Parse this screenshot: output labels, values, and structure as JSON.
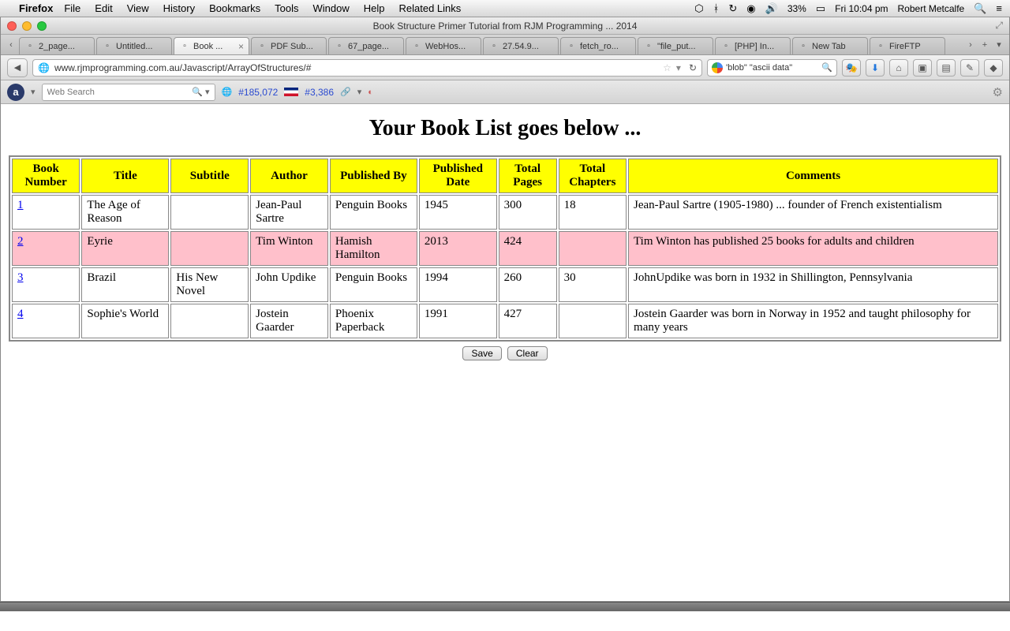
{
  "menubar": {
    "app": "Firefox",
    "items": [
      "File",
      "Edit",
      "View",
      "History",
      "Bookmarks",
      "Tools",
      "Window",
      "Help",
      "Related Links"
    ],
    "battery": "33%",
    "time": "Fri 10:04 pm",
    "user": "Robert Metcalfe"
  },
  "window": {
    "title": "Book Structure Primer Tutorial from RJM Programming ... 2014"
  },
  "tabs": [
    {
      "label": "2_page...",
      "active": false
    },
    {
      "label": "Untitled...",
      "active": false
    },
    {
      "label": "Book ...",
      "active": true
    },
    {
      "label": "PDF Sub...",
      "active": false
    },
    {
      "label": "67_page...",
      "active": false
    },
    {
      "label": "WebHos...",
      "active": false
    },
    {
      "label": "27.54.9...",
      "active": false
    },
    {
      "label": "fetch_ro...",
      "active": false
    },
    {
      "label": "\"file_put...",
      "active": false
    },
    {
      "label": "[PHP] In...",
      "active": false
    },
    {
      "label": "New Tab",
      "active": false
    },
    {
      "label": "FireFTP",
      "active": false
    }
  ],
  "url": "www.rjmprogramming.com.au/Javascript/ArrayOfStructures/#",
  "search": {
    "value": "'blob\" \"ascii data\"",
    "search_icon": "🔍"
  },
  "toolbar2": {
    "websearch_placeholder": "Web Search",
    "rank_global": "#185,072",
    "rank_local": "#3,386"
  },
  "page": {
    "heading": "Your Book List goes below ...",
    "columns": [
      "Book Number",
      "Title",
      "Subtitle",
      "Author",
      "Published By",
      "Published Date",
      "Total Pages",
      "Total Chapters",
      "Comments"
    ],
    "rows": [
      {
        "num": "1",
        "title": "The Age of Reason",
        "subtitle": "",
        "author": "Jean-Paul Sartre",
        "publisher": "Penguin Books",
        "date": "1945",
        "pages": "300",
        "chapters": "18",
        "comments": "Jean-Paul Sartre (1905-1980) ... founder of French existentialism",
        "highlight": false
      },
      {
        "num": "2",
        "title": "Eyrie",
        "subtitle": "",
        "author": "Tim Winton",
        "publisher": "Hamish Hamilton",
        "date": "2013",
        "pages": "424",
        "chapters": "",
        "comments": "Tim Winton has published 25 books for adults and children",
        "highlight": true
      },
      {
        "num": "3",
        "title": "Brazil",
        "subtitle": "His New Novel",
        "author": "John Updike",
        "publisher": "Penguin Books",
        "date": "1994",
        "pages": "260",
        "chapters": "30",
        "comments": "JohnUpdike was born in 1932 in Shillington, Pennsylvania",
        "highlight": false
      },
      {
        "num": "4",
        "title": "Sophie's World",
        "subtitle": "",
        "author": "Jostein Gaarder",
        "publisher": "Phoenix Paperback",
        "date": "1991",
        "pages": "427",
        "chapters": "",
        "comments": "Jostein Gaarder was born in Norway in 1952 and taught philosophy for many years",
        "highlight": false
      }
    ],
    "buttons": {
      "save": "Save",
      "clear": "Clear"
    }
  }
}
